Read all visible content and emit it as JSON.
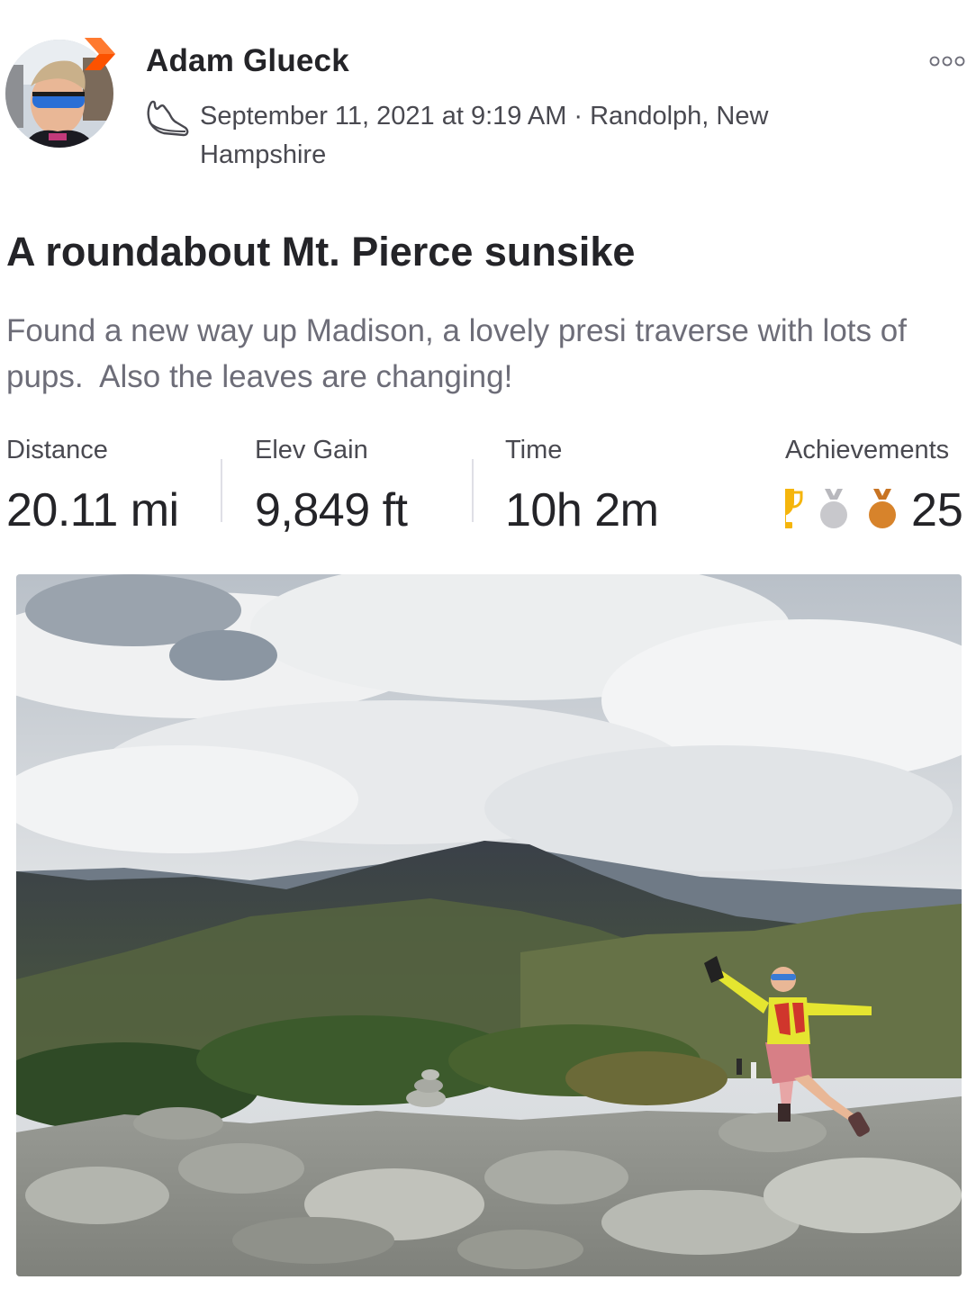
{
  "header": {
    "athlete_name": "Adam Glueck",
    "activity_icon": "shoe-icon",
    "date_location": "September 11, 2021 at 9:19 AM · Randolph, New Hampshire",
    "more_icon": "more-dots-icon",
    "badge_icon": "subscriber-badge-icon"
  },
  "activity": {
    "title": "A roundabout Mt. Pierce sunsike",
    "description": "Found a new way up Madison, a lovely presi traverse with lots of pups.  Also the leaves are changing!"
  },
  "stats": {
    "distance": {
      "label": "Distance",
      "value": "20.11 mi"
    },
    "elev_gain": {
      "label": "Elev Gain",
      "value": "9,849 ft"
    },
    "time": {
      "label": "Time",
      "value": "10h 2m"
    },
    "achievements": {
      "label": "Achievements",
      "count": "25",
      "icons": [
        "trophy-icon",
        "silver-medal-icon",
        "bronze-medal-icon"
      ]
    }
  },
  "colors": {
    "brand_orange": "#fc5200",
    "gold": "#f5b50c",
    "silver": "#c8c8cc",
    "bronze": "#d7832b",
    "text_primary": "#242428",
    "text_secondary": "#6d6d78"
  }
}
